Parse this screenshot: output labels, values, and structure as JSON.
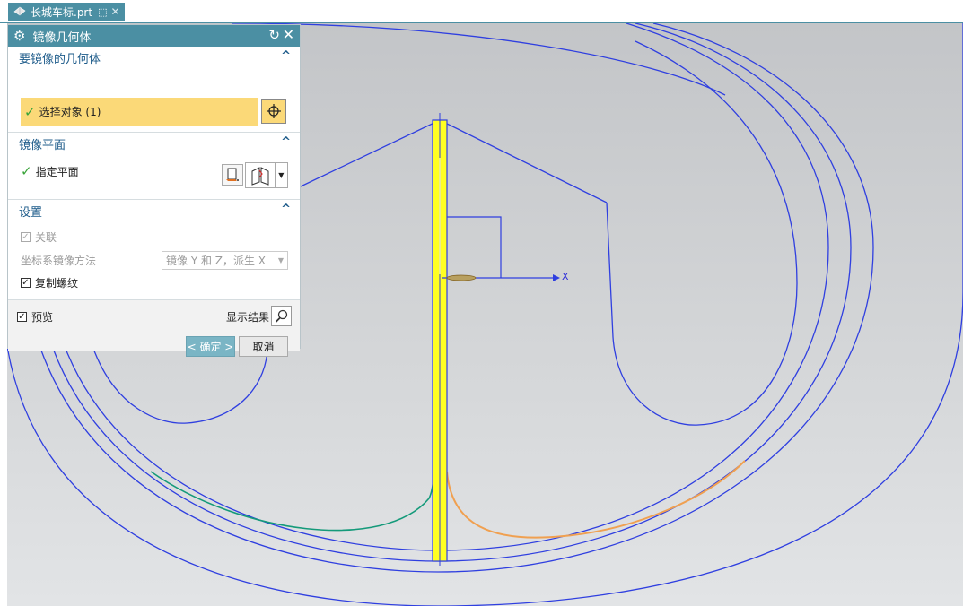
{
  "tab": {
    "filename": "长城车标.prt"
  },
  "dialog": {
    "title": "镜像几何体",
    "sections": {
      "geometry": {
        "header": "要镜像的几何体",
        "select_label": "选择对象 (1)"
      },
      "plane": {
        "header": "镜像平面",
        "specify_label": "指定平面"
      },
      "settings": {
        "header": "设置",
        "associative_label": "关联",
        "csys_method_label": "坐标系镜像方法",
        "csys_method_value": "镜像 Y 和 Z，派生 X",
        "copy_threads_label": "复制螺纹"
      }
    },
    "preview_label": "预览",
    "show_result_label": "显示结果",
    "ok_label": "< 确定 >",
    "cancel_label": "取消"
  },
  "viewport": {
    "axis_label": "X"
  },
  "colors": {
    "accent": "#4b8fa3",
    "curve": "#2f3fe0",
    "selected": "#fbd978",
    "plane": "#ffff22",
    "orange_curve": "#f0a050",
    "green_curve": "#149a7a"
  }
}
